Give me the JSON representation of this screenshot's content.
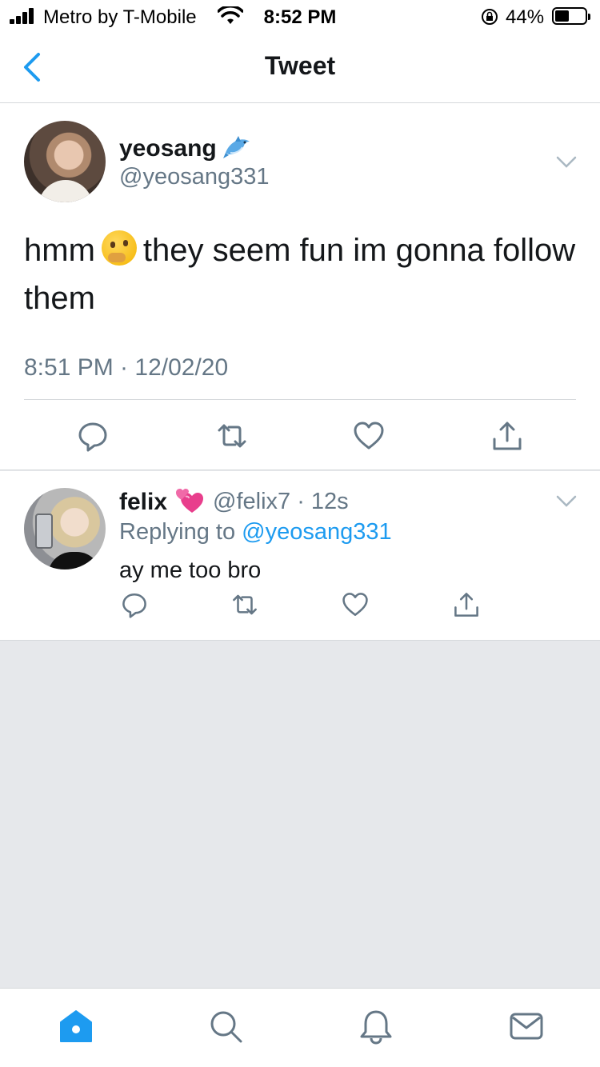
{
  "status_bar": {
    "carrier": "Metro by T-Mobile",
    "time": "8:52 PM",
    "battery_percent": "44%",
    "battery_level": 0.44,
    "icons": [
      "signal-icon",
      "wifi-icon",
      "rotation-lock-icon",
      "battery-icon"
    ]
  },
  "header": {
    "title": "Tweet",
    "back_icon": "chevron-left-icon"
  },
  "main_tweet": {
    "name": "yeosang",
    "name_emoji": "dolphin-emoji",
    "handle": "@yeosang331",
    "text_before": "hmm",
    "text_emoji": "thinking-face-emoji",
    "text_after": "they seem fun im gonna follow them",
    "timestamp": "8:51 PM · 12/02/20",
    "actions": [
      "reply-icon",
      "retweet-icon",
      "like-icon",
      "share-icon"
    ]
  },
  "reply": {
    "name": "felix",
    "name_emoji": "revolving-hearts-emoji",
    "handle_time": "@felix7 · 12s",
    "replying_prefix": "Replying to",
    "replying_to": "@yeosang331",
    "text": "ay me too bro",
    "actions": [
      "reply-icon",
      "retweet-icon",
      "like-icon",
      "share-icon"
    ]
  },
  "tab_bar": {
    "tabs": [
      "home-icon",
      "search-icon",
      "notifications-icon",
      "messages-icon"
    ],
    "active_tab": "home-icon"
  },
  "colors": {
    "accent": "#1d9bf0",
    "secondary_text": "#657786",
    "background": "#e6e8eb"
  }
}
